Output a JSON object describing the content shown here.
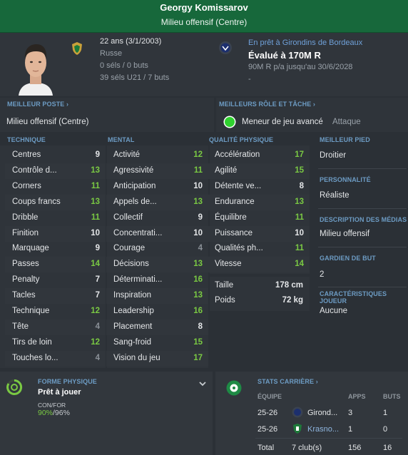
{
  "player": {
    "name": "Georgy Komissarov",
    "position": "Milieu offensif (Centre)",
    "age": "22 ans (3/1/2003)",
    "nationality": "Russe",
    "caps": "0 séls / 0 buts",
    "u21_caps": "39 séls U21 / 7 buts",
    "loan": "En prêt à Girondins de Bordeaux",
    "valuation": "Évalué à 170M R",
    "wage": "90M R p/a jusqu'au 30/6/2028",
    "dash": "-"
  },
  "best_position": {
    "heading": "MEILLEUR POSTE",
    "value": "Milieu offensif (Centre)"
  },
  "best_role": {
    "heading": "MEILLEURS RÔLE ET TÂCHE",
    "role": "Meneur de jeu avancé",
    "duty": "Attaque"
  },
  "technique": {
    "heading": "TECHNIQUE",
    "attrs": [
      {
        "label": "Centres",
        "value": "9",
        "tone": "white"
      },
      {
        "label": "Contrôle d...",
        "value": "13",
        "tone": "green"
      },
      {
        "label": "Corners",
        "value": "11",
        "tone": "green"
      },
      {
        "label": "Coups francs",
        "value": "13",
        "tone": "green"
      },
      {
        "label": "Dribble",
        "value": "11",
        "tone": "green"
      },
      {
        "label": "Finition",
        "value": "10",
        "tone": "white"
      },
      {
        "label": "Marquage",
        "value": "9",
        "tone": "white"
      },
      {
        "label": "Passes",
        "value": "14",
        "tone": "green"
      },
      {
        "label": "Penalty",
        "value": "7",
        "tone": "white"
      },
      {
        "label": "Tacles",
        "value": "7",
        "tone": "white"
      },
      {
        "label": "Technique",
        "value": "12",
        "tone": "green"
      },
      {
        "label": "Tête",
        "value": "4",
        "tone": "grey"
      },
      {
        "label": "Tirs de loin",
        "value": "12",
        "tone": "green"
      },
      {
        "label": "Touches lo...",
        "value": "4",
        "tone": "grey"
      }
    ]
  },
  "mental": {
    "heading": "MENTAL",
    "attrs": [
      {
        "label": "Activité",
        "value": "12",
        "tone": "green"
      },
      {
        "label": "Agressivité",
        "value": "11",
        "tone": "green"
      },
      {
        "label": "Anticipation",
        "value": "10",
        "tone": "white"
      },
      {
        "label": "Appels de...",
        "value": "13",
        "tone": "green"
      },
      {
        "label": "Collectif",
        "value": "9",
        "tone": "white"
      },
      {
        "label": "Concentrati...",
        "value": "10",
        "tone": "white"
      },
      {
        "label": "Courage",
        "value": "4",
        "tone": "grey"
      },
      {
        "label": "Décisions",
        "value": "13",
        "tone": "green"
      },
      {
        "label": "Déterminati...",
        "value": "16",
        "tone": "green"
      },
      {
        "label": "Inspiration",
        "value": "13",
        "tone": "green"
      },
      {
        "label": "Leadership",
        "value": "16",
        "tone": "green"
      },
      {
        "label": "Placement",
        "value": "8",
        "tone": "white"
      },
      {
        "label": "Sang-froid",
        "value": "15",
        "tone": "green"
      },
      {
        "label": "Vision du jeu",
        "value": "17",
        "tone": "green"
      }
    ]
  },
  "physical": {
    "heading": "QUALITÉ PHYSIQUE",
    "attrs": [
      {
        "label": "Accélération",
        "value": "17",
        "tone": "green"
      },
      {
        "label": "Agilité",
        "value": "15",
        "tone": "green"
      },
      {
        "label": "Détente ve...",
        "value": "8",
        "tone": "white"
      },
      {
        "label": "Endurance",
        "value": "13",
        "tone": "green"
      },
      {
        "label": "Équilibre",
        "value": "11",
        "tone": "green"
      },
      {
        "label": "Puissance",
        "value": "10",
        "tone": "white"
      },
      {
        "label": "Qualités ph...",
        "value": "11",
        "tone": "green"
      },
      {
        "label": "Vitesse",
        "value": "14",
        "tone": "green"
      }
    ],
    "height_label": "Taille",
    "height": "178 cm",
    "weight_label": "Poids",
    "weight": "72 kg"
  },
  "side": {
    "foot_heading": "MEILLEUR PIED",
    "foot": "Droitier",
    "personality_heading": "PERSONNALITÉ",
    "personality": "Réaliste",
    "media_heading": "DESCRIPTION DES MÉDIAS",
    "media": "Milieu offensif",
    "gk_heading": "GARDIEN DE BUT",
    "gk": "2",
    "traits_heading": "CARACTÉRISTIQUES JOUEUR",
    "traits": "Aucune"
  },
  "fitness": {
    "heading": "FORME PHYSIQUE",
    "status": "Prêt à jouer",
    "cond_label": "CON/FOR",
    "cond_value": "90%",
    "sharp_value": "/96%",
    "accent": "#7ac943"
  },
  "career": {
    "heading": "STATS CARRIÈRE",
    "col_team": "ÉQUIPE",
    "col_apps": "APPS",
    "col_goals": "BUTS",
    "rows": [
      {
        "season": "25-26",
        "team": "Girond...",
        "apps": "3",
        "goals": "1"
      },
      {
        "season": "25-26",
        "team": "Krasno...",
        "apps": "1",
        "goals": "0"
      }
    ],
    "total_label": "Total",
    "total_clubs": "7 club(s)",
    "total_apps": "156",
    "total_goals": "16"
  },
  "icons": {
    "expand": "chevron-down-icon",
    "link": "chevron-right-icon",
    "stats": "football-icon",
    "fitness": "fitness-ring-icon"
  },
  "colors": {
    "green": "#7ac943",
    "header": "#17683b",
    "link": "#6d9cc4"
  }
}
